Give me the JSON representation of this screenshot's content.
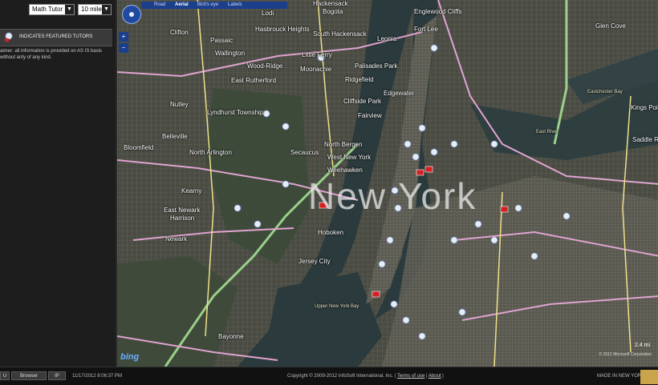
{
  "sidebar": {
    "subject_select": "Math Tutor",
    "distance_select": "10 miles",
    "featured_label": "INDICATES FEATURED TUTORS",
    "disclaimer": "aimer: all information is provided on AS IS basis without anty of any kind."
  },
  "map": {
    "toolbar": {
      "road": "Road",
      "aerial": "Aerial",
      "birds_eye": "Bird's eye",
      "labels": "Labels"
    },
    "city_label": "New York",
    "places": [
      "Clifton",
      "Passaic",
      "Wallington",
      "Nutley",
      "Belleville",
      "North Arlington",
      "Bloomfield",
      "Kearny",
      "East Newark",
      "Harrison",
      "Newark",
      "Lyndhurst Township",
      "East Rutherford",
      "Wood-Ridge",
      "Moonachie",
      "Little Ferry",
      "Ridgefield",
      "Palisades Park",
      "Cliffside Park",
      "Fairview",
      "North Bergen",
      "West New York",
      "Weehawken",
      "Secaucus",
      "Hoboken",
      "Jersey City",
      "Bayonne",
      "Edgewater",
      "Leonia",
      "Englewood Cliffs",
      "Fort Lee",
      "Bogota",
      "Hackensack",
      "Lodi",
      "Hasbrouck Heights",
      "South Hackensack",
      "Upper New York Bay",
      "Kings Point",
      "Saddle Rock",
      "Eastchester Bay",
      "East River",
      "Glen Cove"
    ],
    "bing_logo": "bing",
    "scale": "2.4 mi",
    "copyright_small": "© 2012 Microsoft Corporation"
  },
  "status": {
    "btn1": "U",
    "btn2": "Browser",
    "btn3": "IP",
    "datetime": "11/17/2012 8:06:37 PM",
    "copyright": "Copyright © 2009-2012 InfoSoft International, Inc. |",
    "terms": "Terms of use",
    "sep": "|",
    "about": "About",
    "trail": "|",
    "made_in": "MADE IN NEW YORK"
  },
  "colors": {
    "water": "#2b3a3c",
    "toolbar": "#1c3f8c",
    "featured_pin": "#d42020"
  }
}
